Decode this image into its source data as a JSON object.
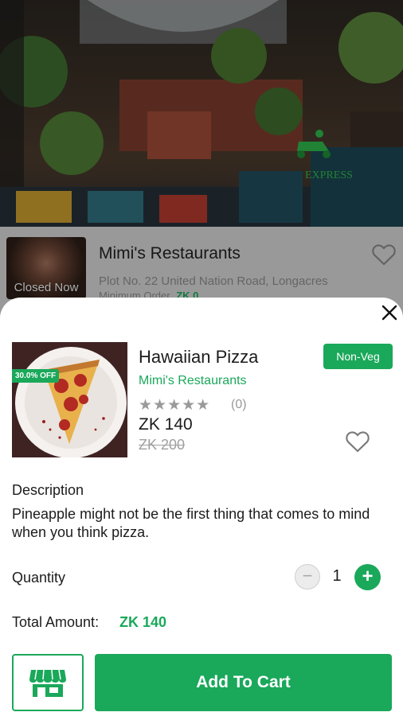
{
  "colors": {
    "accent": "#1aa85a",
    "text": "#1c1c1c",
    "muted": "#9a9a9a"
  },
  "background_page": {
    "restaurant": {
      "name": "Mimi's Restaurants",
      "status": "Closed Now",
      "address": "Plot No. 22 United Nation Road, Longacres",
      "min_order_label": "Minimum Order",
      "min_order_value": "ZK 0",
      "hero_sign": "EXPRESS"
    }
  },
  "sheet": {
    "close_icon": "close-icon",
    "product": {
      "name": "Hawaiian Pizza",
      "restaurant": "Mimi's Restaurants",
      "badge": "Non-Veg",
      "discount": "30.0% OFF",
      "stars": "★★★★★",
      "rating_count": "(0)",
      "price": "ZK 140",
      "old_price": "ZK 200"
    },
    "description": {
      "title": "Description",
      "text": "Pineapple might not be the first thing that comes to mind when you think pizza."
    },
    "quantity": {
      "label": "Quantity",
      "value": "1",
      "minus": "−",
      "plus": "+"
    },
    "total": {
      "label": "Total Amount:",
      "value": "ZK 140"
    },
    "actions": {
      "store_icon": "store-icon",
      "add_to_cart": "Add To Cart"
    }
  }
}
